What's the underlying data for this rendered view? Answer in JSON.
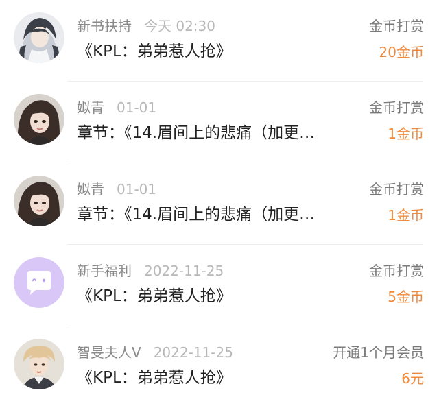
{
  "records": [
    {
      "avatar_icon": "ancient-style-character-avatar",
      "name": "新书扶持",
      "time": "今天 02:30",
      "type": "金币打赏",
      "title": "《KPL：弟弟惹人抢》",
      "amount": "20金币"
    },
    {
      "avatar_icon": "girl-photo-avatar",
      "name": "姒青",
      "time": "01-01",
      "type": "金币打赏",
      "title": "章节：《14.眉间上的悲痛（加更…",
      "amount": "1金币"
    },
    {
      "avatar_icon": "girl-photo-avatar",
      "name": "姒青",
      "time": "01-01",
      "type": "金币打赏",
      "title": "章节：《14.眉间上的悲痛（加更…",
      "amount": "1金币"
    },
    {
      "avatar_icon": "purple-chat-bubble-avatar",
      "name": "新手福利",
      "time": "2022-11-25",
      "type": "金币打赏",
      "title": "《KPL：弟弟惹人抢》",
      "amount": "5金币"
    },
    {
      "avatar_icon": "boy-photo-avatar",
      "name": "智旻夫人V",
      "time": "2022-11-25",
      "type": "开通1个月会员",
      "title": "《KPL：弟弟惹人抢》",
      "amount": "6元"
    }
  ],
  "colors": {
    "amount": "#f08a3c",
    "name": "#8a8a8a",
    "time": "#b8b8b8",
    "title": "#222222",
    "type": "#7a7a7a",
    "chat_avatar_bg": "#d9c8f7"
  }
}
